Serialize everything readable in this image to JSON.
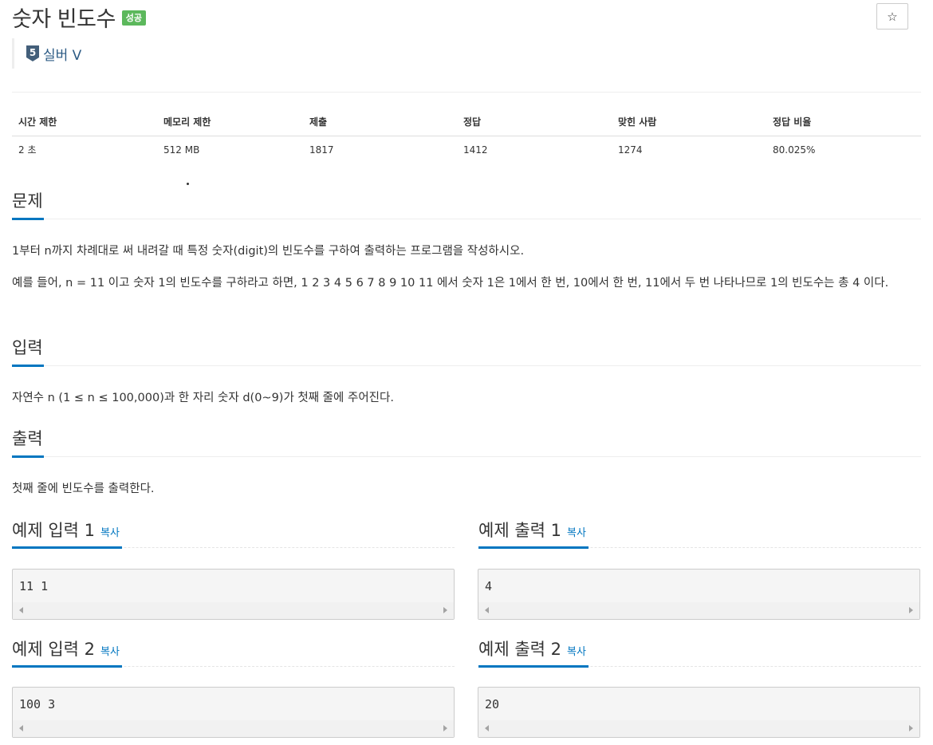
{
  "problem": {
    "title": "숫자 빈도수",
    "status_badge": "성공",
    "tier_number": "5",
    "tier_label": "실버 V",
    "star_icon": "☆"
  },
  "info_table": {
    "headers": [
      "시간 제한",
      "메모리 제한",
      "제출",
      "정답",
      "맞힌 사람",
      "정답 비율"
    ],
    "values": [
      "2 초",
      "512 MB",
      "1817",
      "1412",
      "1274",
      "80.025%"
    ]
  },
  "sections": {
    "problem": {
      "heading": "문제",
      "paragraphs": [
        "1부터 n까지 차례대로 써 내려갈 때 특정 숫자(digit)의 빈도수를 구하여 출력하는 프로그램을 작성하시오.",
        "예를 들어, n = 11 이고 숫자 1의 빈도수를 구하라고 하면, 1 2 3 4 5 6 7 8 9 10 11 에서 숫자 1은 1에서 한 번, 10에서 한 번, 11에서 두 번 나타나므로 1의 빈도수는 총 4 이다."
      ]
    },
    "input": {
      "heading": "입력",
      "text": "자연수 n (1 ≤ n ≤ 100,000)과 한 자리 숫자 d(0~9)가 첫째 줄에 주어진다."
    },
    "output": {
      "heading": "출력",
      "text": "첫째 줄에 빈도수를 출력한다."
    }
  },
  "samples": {
    "copy_label": "복사",
    "input_1": {
      "label": "예제 입력 1",
      "code": "11 1"
    },
    "output_1": {
      "label": "예제 출력 1",
      "code": "4"
    },
    "input_2": {
      "label": "예제 입력 2",
      "code": "100 3"
    },
    "output_2": {
      "label": "예제 출력 2",
      "code": "20"
    }
  },
  "colors": {
    "accent": "#0076c0",
    "success_badge": "#5cb85c",
    "tier_silver": "#435f7a"
  }
}
